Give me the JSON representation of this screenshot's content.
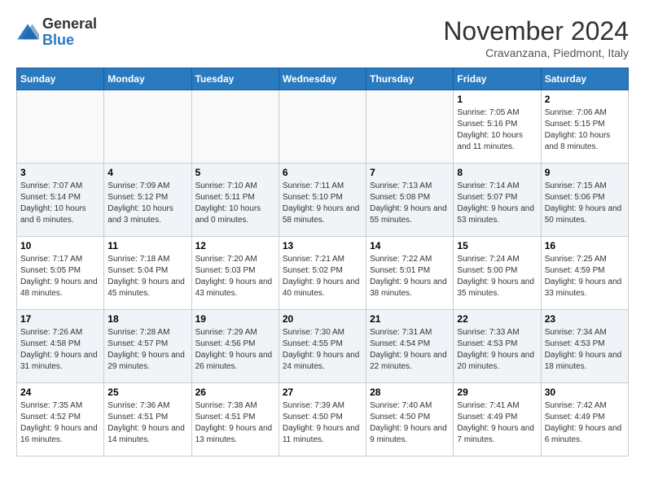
{
  "logo": {
    "general": "General",
    "blue": "Blue"
  },
  "title": "November 2024",
  "subtitle": "Cravanzana, Piedmont, Italy",
  "days_of_week": [
    "Sunday",
    "Monday",
    "Tuesday",
    "Wednesday",
    "Thursday",
    "Friday",
    "Saturday"
  ],
  "weeks": [
    [
      {
        "day": "",
        "info": ""
      },
      {
        "day": "",
        "info": ""
      },
      {
        "day": "",
        "info": ""
      },
      {
        "day": "",
        "info": ""
      },
      {
        "day": "",
        "info": ""
      },
      {
        "day": "1",
        "info": "Sunrise: 7:05 AM\nSunset: 5:16 PM\nDaylight: 10 hours and 11 minutes."
      },
      {
        "day": "2",
        "info": "Sunrise: 7:06 AM\nSunset: 5:15 PM\nDaylight: 10 hours and 8 minutes."
      }
    ],
    [
      {
        "day": "3",
        "info": "Sunrise: 7:07 AM\nSunset: 5:14 PM\nDaylight: 10 hours and 6 minutes."
      },
      {
        "day": "4",
        "info": "Sunrise: 7:09 AM\nSunset: 5:12 PM\nDaylight: 10 hours and 3 minutes."
      },
      {
        "day": "5",
        "info": "Sunrise: 7:10 AM\nSunset: 5:11 PM\nDaylight: 10 hours and 0 minutes."
      },
      {
        "day": "6",
        "info": "Sunrise: 7:11 AM\nSunset: 5:10 PM\nDaylight: 9 hours and 58 minutes."
      },
      {
        "day": "7",
        "info": "Sunrise: 7:13 AM\nSunset: 5:08 PM\nDaylight: 9 hours and 55 minutes."
      },
      {
        "day": "8",
        "info": "Sunrise: 7:14 AM\nSunset: 5:07 PM\nDaylight: 9 hours and 53 minutes."
      },
      {
        "day": "9",
        "info": "Sunrise: 7:15 AM\nSunset: 5:06 PM\nDaylight: 9 hours and 50 minutes."
      }
    ],
    [
      {
        "day": "10",
        "info": "Sunrise: 7:17 AM\nSunset: 5:05 PM\nDaylight: 9 hours and 48 minutes."
      },
      {
        "day": "11",
        "info": "Sunrise: 7:18 AM\nSunset: 5:04 PM\nDaylight: 9 hours and 45 minutes."
      },
      {
        "day": "12",
        "info": "Sunrise: 7:20 AM\nSunset: 5:03 PM\nDaylight: 9 hours and 43 minutes."
      },
      {
        "day": "13",
        "info": "Sunrise: 7:21 AM\nSunset: 5:02 PM\nDaylight: 9 hours and 40 minutes."
      },
      {
        "day": "14",
        "info": "Sunrise: 7:22 AM\nSunset: 5:01 PM\nDaylight: 9 hours and 38 minutes."
      },
      {
        "day": "15",
        "info": "Sunrise: 7:24 AM\nSunset: 5:00 PM\nDaylight: 9 hours and 35 minutes."
      },
      {
        "day": "16",
        "info": "Sunrise: 7:25 AM\nSunset: 4:59 PM\nDaylight: 9 hours and 33 minutes."
      }
    ],
    [
      {
        "day": "17",
        "info": "Sunrise: 7:26 AM\nSunset: 4:58 PM\nDaylight: 9 hours and 31 minutes."
      },
      {
        "day": "18",
        "info": "Sunrise: 7:28 AM\nSunset: 4:57 PM\nDaylight: 9 hours and 29 minutes."
      },
      {
        "day": "19",
        "info": "Sunrise: 7:29 AM\nSunset: 4:56 PM\nDaylight: 9 hours and 26 minutes."
      },
      {
        "day": "20",
        "info": "Sunrise: 7:30 AM\nSunset: 4:55 PM\nDaylight: 9 hours and 24 minutes."
      },
      {
        "day": "21",
        "info": "Sunrise: 7:31 AM\nSunset: 4:54 PM\nDaylight: 9 hours and 22 minutes."
      },
      {
        "day": "22",
        "info": "Sunrise: 7:33 AM\nSunset: 4:53 PM\nDaylight: 9 hours and 20 minutes."
      },
      {
        "day": "23",
        "info": "Sunrise: 7:34 AM\nSunset: 4:53 PM\nDaylight: 9 hours and 18 minutes."
      }
    ],
    [
      {
        "day": "24",
        "info": "Sunrise: 7:35 AM\nSunset: 4:52 PM\nDaylight: 9 hours and 16 minutes."
      },
      {
        "day": "25",
        "info": "Sunrise: 7:36 AM\nSunset: 4:51 PM\nDaylight: 9 hours and 14 minutes."
      },
      {
        "day": "26",
        "info": "Sunrise: 7:38 AM\nSunset: 4:51 PM\nDaylight: 9 hours and 13 minutes."
      },
      {
        "day": "27",
        "info": "Sunrise: 7:39 AM\nSunset: 4:50 PM\nDaylight: 9 hours and 11 minutes."
      },
      {
        "day": "28",
        "info": "Sunrise: 7:40 AM\nSunset: 4:50 PM\nDaylight: 9 hours and 9 minutes."
      },
      {
        "day": "29",
        "info": "Sunrise: 7:41 AM\nSunset: 4:49 PM\nDaylight: 9 hours and 7 minutes."
      },
      {
        "day": "30",
        "info": "Sunrise: 7:42 AM\nSunset: 4:49 PM\nDaylight: 9 hours and 6 minutes."
      }
    ]
  ]
}
